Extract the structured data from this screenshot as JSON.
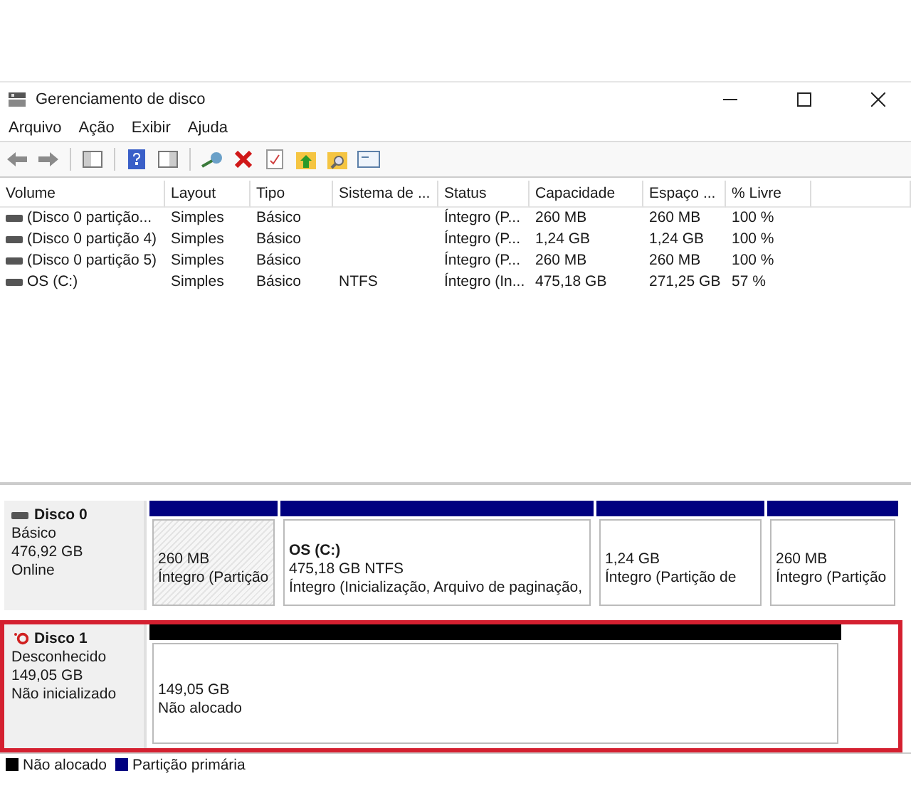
{
  "window": {
    "title": "Gerenciamento de disco"
  },
  "menu": [
    {
      "label": "Arquivo"
    },
    {
      "label": "Ação"
    },
    {
      "label": "Exibir"
    },
    {
      "label": "Ajuda"
    }
  ],
  "table": {
    "columns": [
      "Volume",
      "Layout",
      "Tipo",
      "Sistema de ...",
      "Status",
      "Capacidade",
      "Espaço ...",
      "% Livre"
    ],
    "rows": [
      {
        "cells": [
          "(Disco 0 partição...",
          "Simples",
          "Básico",
          "",
          "Íntegro (P...",
          "260 MB",
          "260 MB",
          "100 %"
        ],
        "selected": false
      },
      {
        "cells": [
          "(Disco 0 partição 4)",
          "Simples",
          "Básico",
          "",
          "Íntegro (P...",
          "1,24 GB",
          "1,24 GB",
          "100 %"
        ],
        "selected": false
      },
      {
        "cells": [
          "(Disco 0 partição 5)",
          "Simples",
          "Básico",
          "",
          "Íntegro (P...",
          "260 MB",
          "260 MB",
          "100 %"
        ],
        "selected": false
      },
      {
        "cells": [
          "OS (C:)",
          "Simples",
          "Básico",
          "NTFS",
          "Íntegro (In...",
          "475,18 GB",
          "271,25 GB",
          "57 %"
        ],
        "selected": false
      }
    ]
  },
  "disks": [
    {
      "name": "Disco 0",
      "kind": "online",
      "type": "Básico",
      "size": "476,92 GB",
      "status": "Online",
      "highlighted": false,
      "partitions": [
        {
          "kind": "primary",
          "size": "260 MB",
          "status": "Íntegro (Partição",
          "selected": true
        },
        {
          "kind": "primary",
          "label": "OS  (C:)",
          "size": "475,18 GB NTFS",
          "status": "Íntegro (Inicialização, Arquivo de paginação,",
          "selected": false
        },
        {
          "kind": "primary",
          "size": "1,24 GB",
          "status": "Íntegro (Partição de",
          "selected": false
        },
        {
          "kind": "primary",
          "size": "260 MB",
          "status": "Íntegro (Partição",
          "selected": false
        }
      ]
    },
    {
      "name": "Disco 1",
      "kind": "uninitialized",
      "type": "Desconhecido",
      "size": "149,05 GB",
      "status": "Não inicializado",
      "highlighted": true,
      "partitions": [
        {
          "kind": "unallocated",
          "size": "149,05 GB",
          "status": "Não alocado",
          "selected": false
        }
      ]
    }
  ],
  "legend": [
    {
      "label": "Não alocado",
      "color": "#000000"
    },
    {
      "label": "Partição primária",
      "color": "#000080"
    }
  ]
}
